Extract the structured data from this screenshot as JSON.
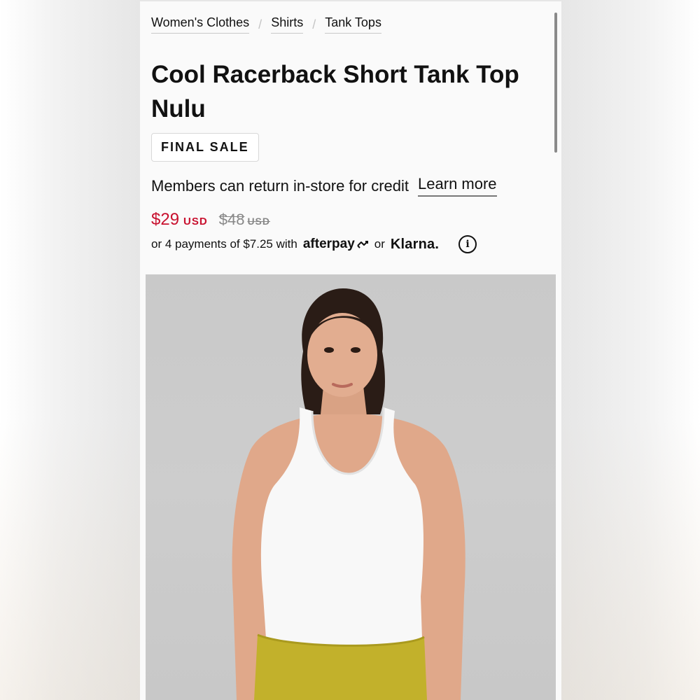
{
  "breadcrumb": [
    "Women's Clothes",
    "Shirts",
    "Tank Tops"
  ],
  "breadcrumb_separator": "/",
  "product": {
    "title": "Cool Racerback Short Tank Top Nulu",
    "badge": "FINAL SALE",
    "members_text": "Members can return in-store for credit",
    "learn_more": "Learn more",
    "price": "$29",
    "price_currency": "USD",
    "original_price": "$48",
    "original_currency": "USD",
    "payments_text": "or 4 payments of $7.25 with",
    "afterpay": "afterpay",
    "or_text": "or",
    "klarna": "Klarna.",
    "info_icon": "i",
    "sale_color": "#c8102e"
  },
  "photo": {
    "subject": "model wearing white racerback tank top and yellow-green leggings",
    "background_color": "#cbcbcb",
    "tank_color": "#ffffff",
    "leggings_color": "#c4b52a"
  }
}
